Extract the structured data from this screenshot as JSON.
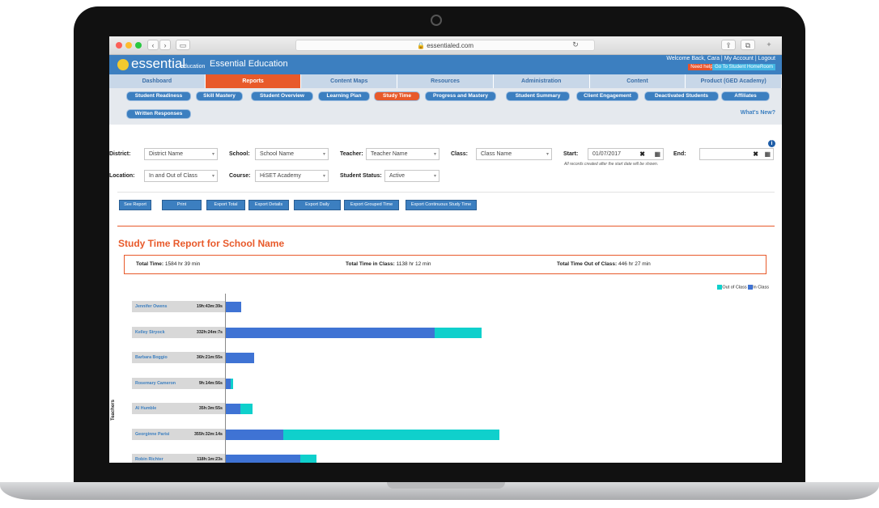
{
  "browser": {
    "url": "essentialed.com"
  },
  "app": {
    "logo_text": "essential",
    "logo_sub": "education",
    "title": "Essential Education",
    "welcome": "Welcome Back, Cara | My Account | Logout",
    "need_help": "Need help?",
    "go_home": "Go To Student HomeRoom"
  },
  "main_nav": [
    "Dashboard",
    "Reports",
    "Content Maps",
    "Resources",
    "Administration",
    "Content",
    "Product (GED Academy)"
  ],
  "sub_nav": [
    "Student Readiness",
    "Skill Mastery",
    "Student Overview",
    "Learning Plan",
    "Study Time",
    "Progress and Mastery",
    "Student Summary",
    "Client Engagement",
    "Deactivated Students",
    "Affiliates",
    "Written Responses"
  ],
  "whats_new": "What's New?",
  "filters": {
    "district_label": "District:",
    "district_value": "District Name",
    "school_label": "School:",
    "school_value": "School Name",
    "teacher_label": "Teacher:",
    "teacher_value": "Teacher Name",
    "class_label": "Class:",
    "class_value": "Class Name",
    "start_label": "Start:",
    "start_value": "01/07/2017",
    "end_label": "End:",
    "end_value": "",
    "start_note": "All records created after the start date will be shown.",
    "location_label": "Location:",
    "location_value": "In and Out of Class",
    "course_label": "Course:",
    "course_value": "HiSET Academy",
    "status_label": "Student Status:",
    "status_value": "Active"
  },
  "actions": [
    "See Report",
    "Print",
    "Export Total",
    "Export Details",
    "Export Daily",
    "Export Grouped Time",
    "Export Continuous Study Time"
  ],
  "report": {
    "title": "Study Time Report for School Name",
    "total_label": "Total Time:",
    "total_value": "1584 hr 39 min",
    "in_label": "Total Time in Class:",
    "in_value": "1138 hr 12 min",
    "out_label": "Total Time Out of Class:",
    "out_value": "446 hr 27 min"
  },
  "chart_data": {
    "type": "bar",
    "orientation": "horizontal",
    "stacked": true,
    "ylabel": "Teachers",
    "legend": [
      "Out of Class",
      "In Class"
    ],
    "colors": {
      "in_class": "#3f73d4",
      "out_of_class": "#0fd0cc"
    },
    "categories": [
      "Jennifer Owens",
      "Kelley Stryock",
      "Barbara Boggio",
      "Rosemary Cameron",
      "Al Humble",
      "Georginne Parisi",
      "Robin Richter"
    ],
    "time_labels": [
      "19h:43m:39s",
      "332h:24m:7s",
      "36h:21m:55s",
      "9h:14m:56s",
      "35h:3m:55s",
      "355h:32m:14s",
      "118h:1m:23s"
    ],
    "series": [
      {
        "name": "In Class",
        "values": [
          19.7,
          272.0,
          36.4,
          6.0,
          19.0,
          75.0,
          97.0
        ]
      },
      {
        "name": "Out of Class",
        "values": [
          0,
          60.4,
          0,
          3.2,
          16.1,
          280.5,
          21.0
        ]
      }
    ]
  }
}
